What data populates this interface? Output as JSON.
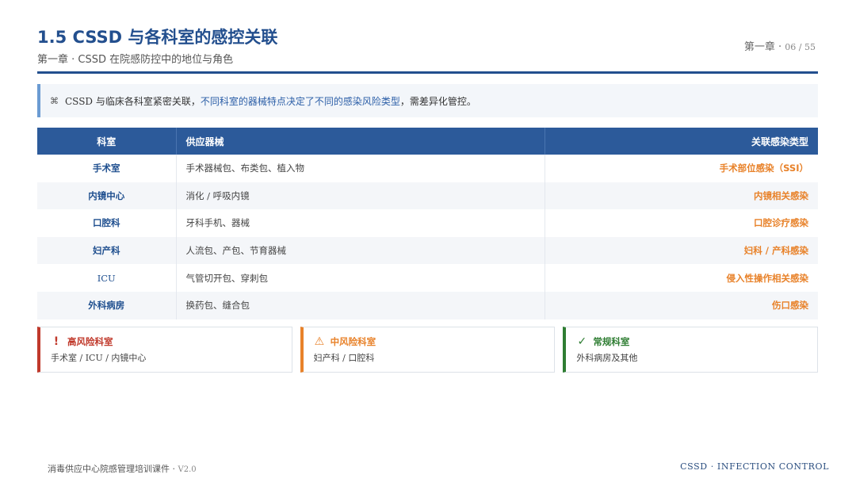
{
  "header": {
    "title": "1.5 CSSD 与各科室的感控关联",
    "subtitle": "第一章 · CSSD 在院感防控中的地位与角色",
    "chapter": "第一章 · ",
    "page": "06",
    "sep": " / ",
    "total": "55"
  },
  "callout": {
    "icon": "⌘",
    "text_a": "CSSD 与临床各科室紧密关联，",
    "text_highlight": "不同科室的器械特点决定了不同的感染风险类型",
    "text_b": "，需差异化管控。"
  },
  "table": {
    "headers": [
      "科室",
      "供应器械",
      "关联感染类型"
    ],
    "rows": [
      {
        "dept": "手术室",
        "equip": "手术器械包、布类包、植入物",
        "risk": "手术部位感染（SSI）"
      },
      {
        "dept": "内镜中心",
        "equip": "消化 / 呼吸内镜",
        "risk": "内镜相关感染"
      },
      {
        "dept": "口腔科",
        "equip": "牙科手机、器械",
        "risk": "口腔诊疗感染"
      },
      {
        "dept": "妇产科",
        "equip": "人流包、产包、节育器械",
        "risk": "妇科 / 产科感染"
      },
      {
        "dept": "ICU",
        "equip": "气管切开包、穿刺包",
        "risk": "侵入性操作相关感染"
      },
      {
        "dept": "外科病房",
        "equip": "换药包、缝合包",
        "risk": "伤口感染"
      }
    ]
  },
  "cards": [
    {
      "icon": "!",
      "title": "高风险科室",
      "body": "手术室 / ICU / 内镜中心",
      "color": "#c0392b"
    },
    {
      "icon": "⚠",
      "title": "中风险科室",
      "body": "妇产科 / 口腔科",
      "color": "#e8822a"
    },
    {
      "icon": "✓",
      "title": "常规科室",
      "body": "外科病房及其他",
      "color": "#2e7d32"
    }
  ],
  "footer": {
    "left": "消毒供应中心院感管理培训课件 · ",
    "version": "V2.0",
    "right": "CSSD · INFECTION CONTROL"
  }
}
